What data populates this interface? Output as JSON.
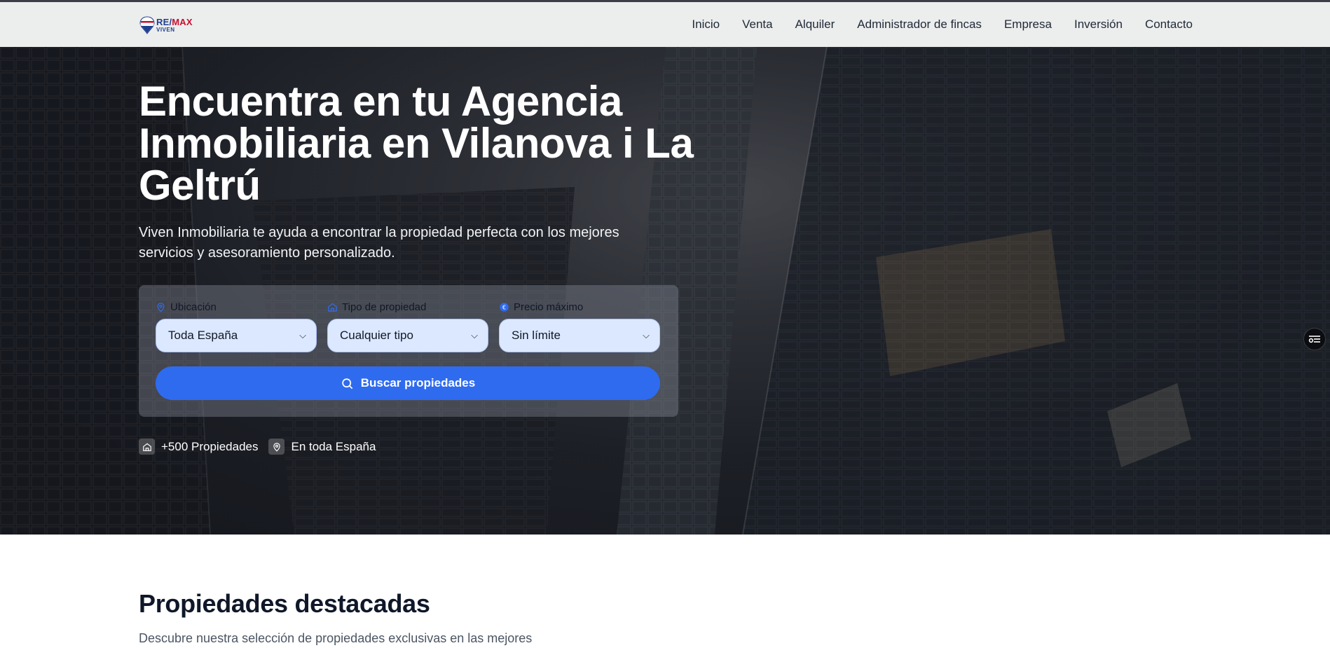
{
  "brand": {
    "name_part1": "RE/",
    "name_part2": "MAX",
    "sub": "VIVEN"
  },
  "nav": {
    "items": [
      "Inicio",
      "Venta",
      "Alquiler",
      "Administrador de fincas",
      "Empresa",
      "Inversión",
      "Contacto"
    ]
  },
  "hero": {
    "title": "Encuentra en tu Agencia Inmobiliaria en Vilanova i La Geltrú",
    "subtitle": "Viven Inmobiliaria te ayuda a encontrar la propiedad perfecta con los mejores servicios y asesoramiento personalizado."
  },
  "search": {
    "location_label": "Ubicación",
    "location_value": "Toda España",
    "type_label": "Tipo de propiedad",
    "type_value": "Cualquier tipo",
    "price_label": "Precio máximo",
    "price_value": "Sin límite",
    "button_label": "Buscar propiedades"
  },
  "stats": {
    "properties": "+500 Propiedades",
    "coverage": "En toda España"
  },
  "featured": {
    "title": "Propiedades destacadas",
    "subtitle": "Descubre nuestra selección de propiedades exclusivas en las mejores"
  },
  "icons": {
    "location": "map-pin-icon",
    "type": "home-icon",
    "price": "euro-icon",
    "search": "search-icon",
    "widget": "settings-sliders-icon"
  },
  "colors": {
    "accent": "#2f6bef",
    "select_bg": "#dce8ff",
    "header_bg": "#eceded",
    "heading": "#0f1729"
  }
}
